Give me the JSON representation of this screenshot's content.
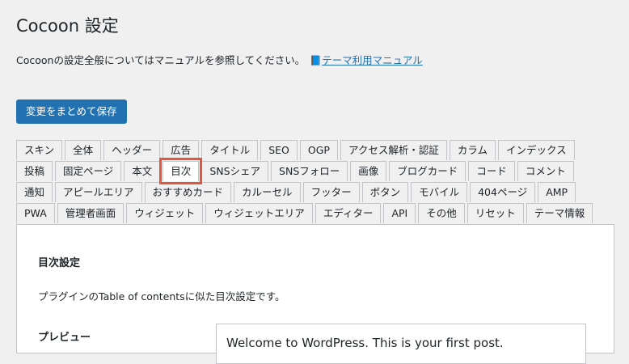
{
  "page": {
    "title": "Cocoon 設定",
    "intro_text": "Cocoonの設定全般についてはマニュアルを参照してください。",
    "manual_link": "テーマ利用マニュアル",
    "save_button": "変更をまとめて保存"
  },
  "tabs": {
    "active": "目次",
    "rows": [
      [
        "スキン",
        "全体",
        "ヘッダー",
        "広告",
        "タイトル",
        "SEO",
        "OGP",
        "アクセス解析・認証",
        "カラム",
        "インデックス"
      ],
      [
        "投稿",
        "固定ページ",
        "本文",
        "目次",
        "SNSシェア",
        "SNSフォロー",
        "画像",
        "ブログカード",
        "コード",
        "コメント"
      ],
      [
        "通知",
        "アピールエリア",
        "おすすめカード",
        "カルーセル",
        "フッター",
        "ボタン",
        "モバイル",
        "404ページ",
        "AMP"
      ],
      [
        "PWA",
        "管理者画面",
        "ウィジェット",
        "ウィジェットエリア",
        "エディター",
        "API",
        "その他",
        "リセット",
        "テーマ情報"
      ]
    ]
  },
  "panel": {
    "title": "目次設定",
    "description": "プラグインのTable of contentsに似た目次設定です。",
    "preview_label": "プレビュー",
    "preview_text": "Welcome to WordPress. This is your first post."
  },
  "icons": {
    "manual_icon": "book-icon"
  },
  "colors": {
    "accent": "#2271b1",
    "highlight": "#e2553f"
  }
}
